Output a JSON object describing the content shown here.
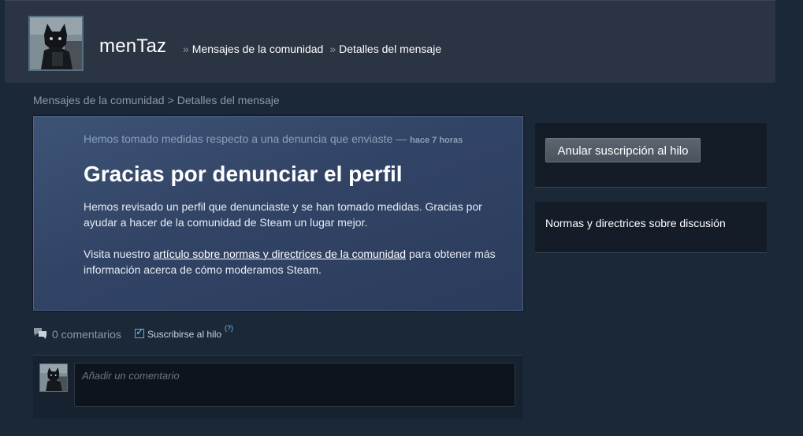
{
  "header": {
    "username": "menTaz",
    "crumb_separator": "»",
    "crumbs": [
      "Mensajes de la comunidad",
      "Detalles del mensaje"
    ]
  },
  "breadcrumb": {
    "items": [
      "Mensajes de la comunidad",
      "Detalles del mensaje"
    ],
    "separator": ">"
  },
  "notice": {
    "subtitle": "Hemos tomado medidas respecto a una denuncia que enviaste —",
    "time": "hace 7 horas",
    "title": "Gracias por denunciar el perfil",
    "paragraph1": "Hemos revisado un perfil que denunciaste y se han tomado medidas. Gracias por ayudar a hacer de la comunidad de Steam un lugar mejor.",
    "paragraph2_before": "Visita nuestro ",
    "paragraph2_link": "artículo sobre normas y directrices de la comunidad",
    "paragraph2_after": " para obtener más información acerca de cómo moderamos Steam."
  },
  "sidebar": {
    "unsubscribe_label": "Anular suscripción al hilo",
    "rules_label": "Normas y directrices sobre discusión"
  },
  "comments": {
    "count_label": "0 comentarios",
    "subscribe_label": "Suscribirse al hilo",
    "subscribe_checked": true,
    "help_label": "(?)",
    "input_placeholder": "Añadir un comentario"
  },
  "icons": {
    "comment": "speech-bubbles-icon",
    "check": "checkmark-icon"
  },
  "colors": {
    "page_bg": "#1b2838",
    "header_bg": "#2a3442",
    "notice_bg": "#34476a",
    "panel_bg": "#141c28",
    "link_blue": "#67c1f5"
  }
}
